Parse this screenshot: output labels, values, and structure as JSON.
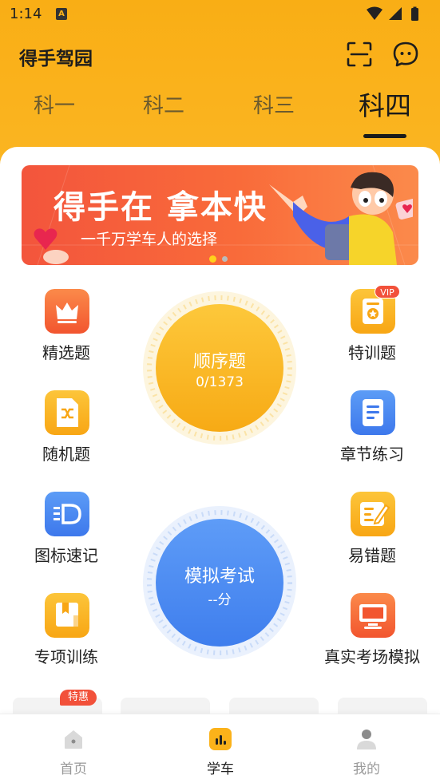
{
  "status_bar": {
    "time": "1:14",
    "a_badge": "A"
  },
  "header": {
    "title": "得手驾园"
  },
  "tabs": [
    {
      "label": "科一"
    },
    {
      "label": "科二"
    },
    {
      "label": "科三"
    },
    {
      "label": "科四",
      "active": true
    }
  ],
  "banner": {
    "title": "得手在 拿本快",
    "subtitle": "一千万学车人的选择"
  },
  "grid": {
    "left": [
      {
        "label": "精选题",
        "icon": "crown-icon"
      },
      {
        "label": "随机题",
        "icon": "shuffle-icon"
      },
      {
        "label": "图标速记",
        "icon": "list-d-icon"
      },
      {
        "label": "专项训练",
        "icon": "bookmark-icon"
      }
    ],
    "right": [
      {
        "label": "特训题",
        "icon": "star-badge-icon",
        "badge": "VIP"
      },
      {
        "label": "章节练习",
        "icon": "document-icon"
      },
      {
        "label": "易错题",
        "icon": "edit-note-icon"
      },
      {
        "label": "真实考场模拟",
        "icon": "monitor-icon"
      }
    ]
  },
  "circles": {
    "sequence": {
      "title": "顺序题",
      "progress": "0/1373"
    },
    "exam": {
      "title": "模拟考试",
      "score": "--分"
    }
  },
  "promo": {
    "tehui_badge": "特惠"
  },
  "bottom_nav": [
    {
      "label": "首页",
      "icon": "home-icon"
    },
    {
      "label": "学车",
      "icon": "chart-icon",
      "active": true
    },
    {
      "label": "我的",
      "icon": "user-icon"
    }
  ],
  "colors": {
    "accent": "#fbb21a",
    "orange": "#f9722f",
    "blue": "#4f8df0",
    "red": "#f2513a"
  }
}
